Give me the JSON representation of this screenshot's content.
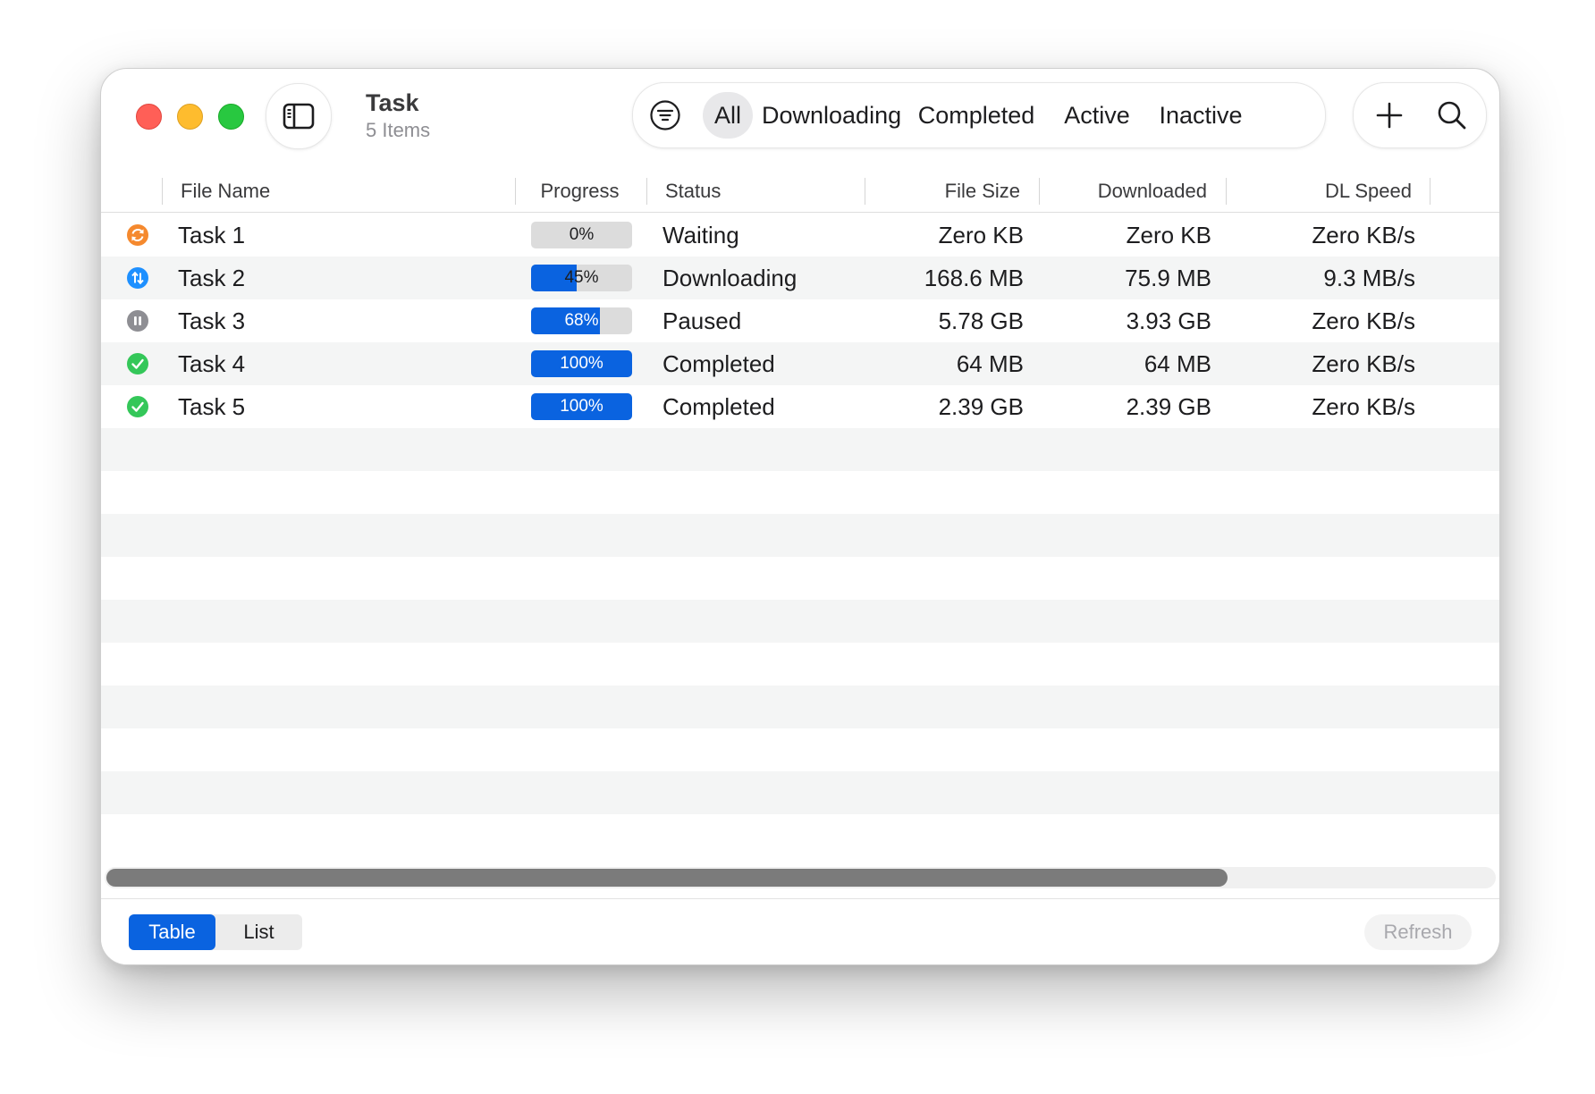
{
  "app": {
    "title": "Task",
    "subtitle": "5 Items"
  },
  "filter": {
    "icon": "filter-icon",
    "segments": [
      "All",
      "Downloading",
      "Completed",
      "Active",
      "Inactive"
    ],
    "selected": "All"
  },
  "actions": {
    "add_icon": "plus-icon",
    "search_icon": "search-icon"
  },
  "table": {
    "columns": {
      "file_name": "File Name",
      "progress": "Progress",
      "status": "Status",
      "file_size": "File Size",
      "downloaded": "Downloaded",
      "dl_speed": "DL Speed"
    },
    "rows": [
      {
        "icon": "waiting-icon",
        "icon_color": "#f5892e",
        "name": "Task 1",
        "progress": 0,
        "progress_label": "0%",
        "status": "Waiting",
        "file_size": "Zero KB",
        "downloaded": "Zero KB",
        "dl_speed": "Zero KB/s"
      },
      {
        "icon": "downloading-icon",
        "icon_color": "#1e90ff",
        "name": "Task 2",
        "progress": 45,
        "progress_label": "45%",
        "status": "Downloading",
        "file_size": "168.6 MB",
        "downloaded": "75.9 MB",
        "dl_speed": "9.3 MB/s"
      },
      {
        "icon": "paused-icon",
        "icon_color": "#8e8e93",
        "name": "Task 3",
        "progress": 68,
        "progress_label": "68%",
        "status": "Paused",
        "file_size": "5.78 GB",
        "downloaded": "3.93 GB",
        "dl_speed": "Zero KB/s"
      },
      {
        "icon": "completed-icon",
        "icon_color": "#34c759",
        "name": "Task 4",
        "progress": 100,
        "progress_label": "100%",
        "status": "Completed",
        "file_size": "64 MB",
        "downloaded": "64 MB",
        "dl_speed": "Zero KB/s"
      },
      {
        "icon": "completed-icon",
        "icon_color": "#34c759",
        "name": "Task 5",
        "progress": 100,
        "progress_label": "100%",
        "status": "Completed",
        "file_size": "2.39 GB",
        "downloaded": "2.39 GB",
        "dl_speed": "Zero KB/s"
      }
    ]
  },
  "horizontal_scrollbar": {
    "visible_fraction": 0.81
  },
  "bottom": {
    "view_modes": [
      "Table",
      "List"
    ],
    "selected_view": "Table",
    "refresh_label": "Refresh"
  },
  "colors": {
    "accent": "#0a63e0",
    "close": "#ff5f57",
    "minimize": "#febc2e",
    "maximize": "#28c840"
  }
}
